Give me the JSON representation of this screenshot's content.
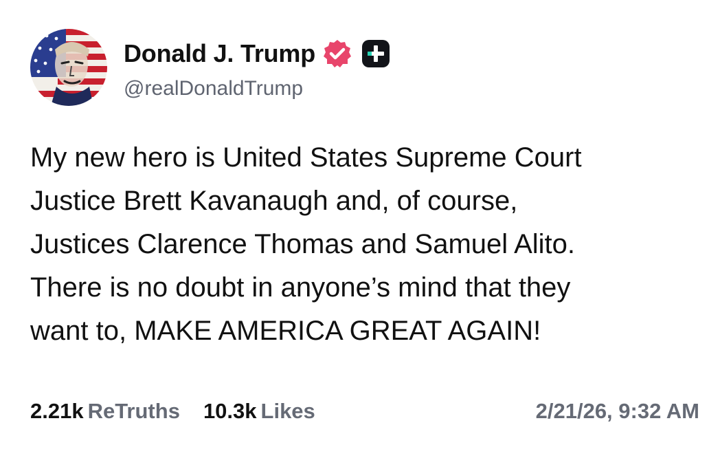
{
  "author": {
    "display_name": "Donald J. Trump",
    "handle": "@realDonaldTrump",
    "verified_icon": "verified-badge-icon",
    "verified_color": "#e8456b",
    "plus_icon": "plus-badge-icon"
  },
  "post": {
    "lines": [
      "My new hero is United States Supreme Court",
      "Justice Brett Kavanaugh and, of course,",
      "Justices Clarence Thomas and Samuel Alito.",
      "There is no doubt in anyone’s mind that they",
      "want to, MAKE AMERICA GREAT AGAIN!"
    ]
  },
  "stats": {
    "retruths_count": "2.21k",
    "retruths_label": "ReTruths",
    "likes_count": "10.3k",
    "likes_label": "Likes",
    "timestamp": "2/21/26, 9:32 AM"
  },
  "colors": {
    "text": "#111111",
    "muted": "#656a75",
    "background": "#ffffff"
  }
}
